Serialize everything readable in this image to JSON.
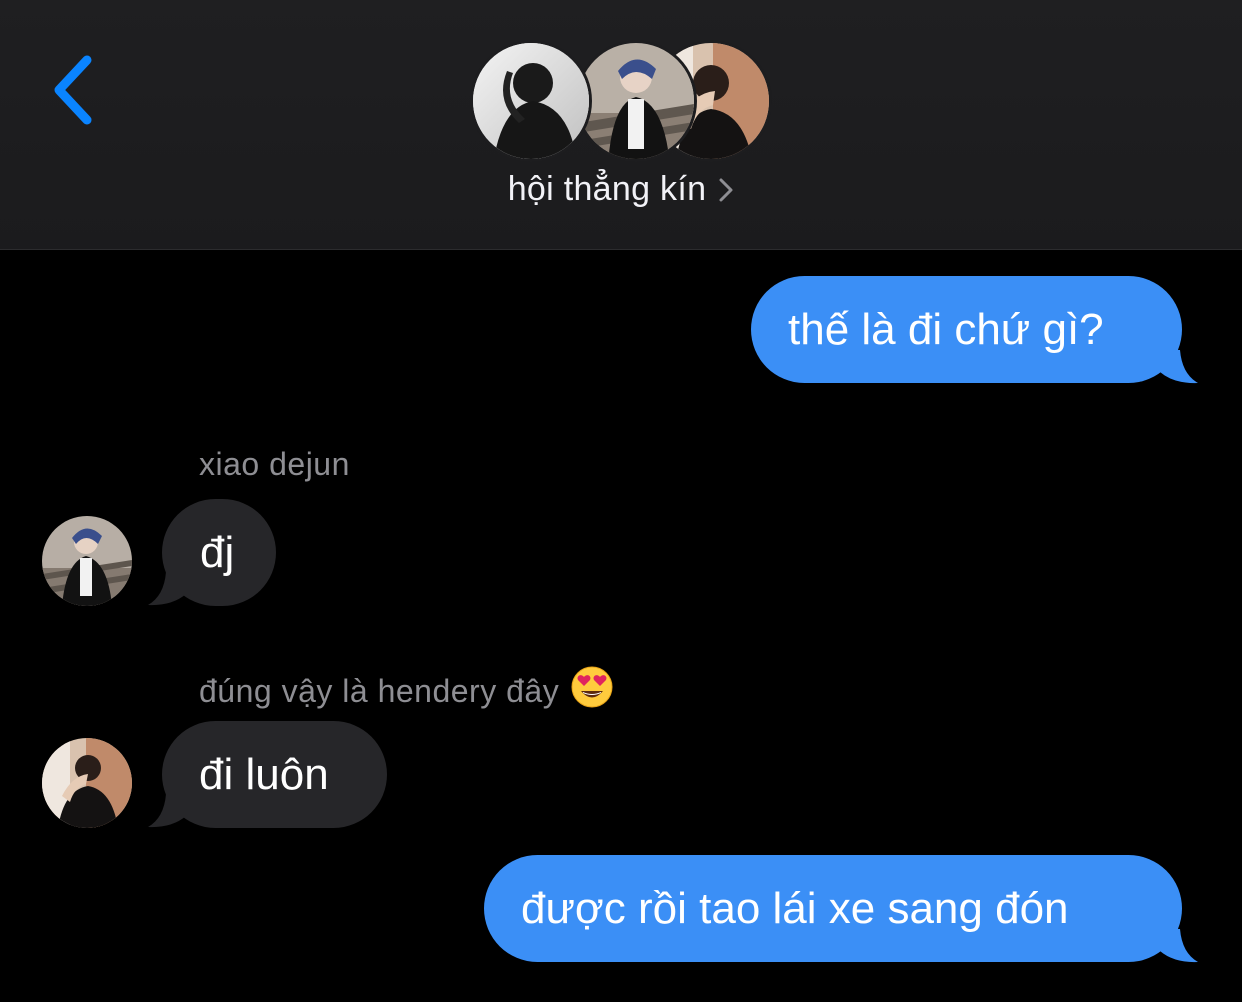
{
  "header": {
    "back_icon": "chevron-left-icon",
    "group_name": "hội thẳng kín",
    "info_icon": "chevron-right-icon",
    "accent_color": "#0a84ff"
  },
  "messages": [
    {
      "direction": "outgoing",
      "text": "thế là đi chứ gì?"
    },
    {
      "direction": "incoming",
      "sender": "xiao dejun",
      "text": "đj"
    },
    {
      "direction": "incoming",
      "sender": "đúng vậy là hendery đây",
      "sender_emoji": "😍",
      "text": "đi luôn"
    },
    {
      "direction": "outgoing",
      "text": "được rồi tao lái xe sang đón"
    }
  ],
  "colors": {
    "outgoing_bubble": "#3b8ff6",
    "incoming_bubble": "#262629",
    "background": "#000000",
    "sender_label": "#8e8e93"
  }
}
